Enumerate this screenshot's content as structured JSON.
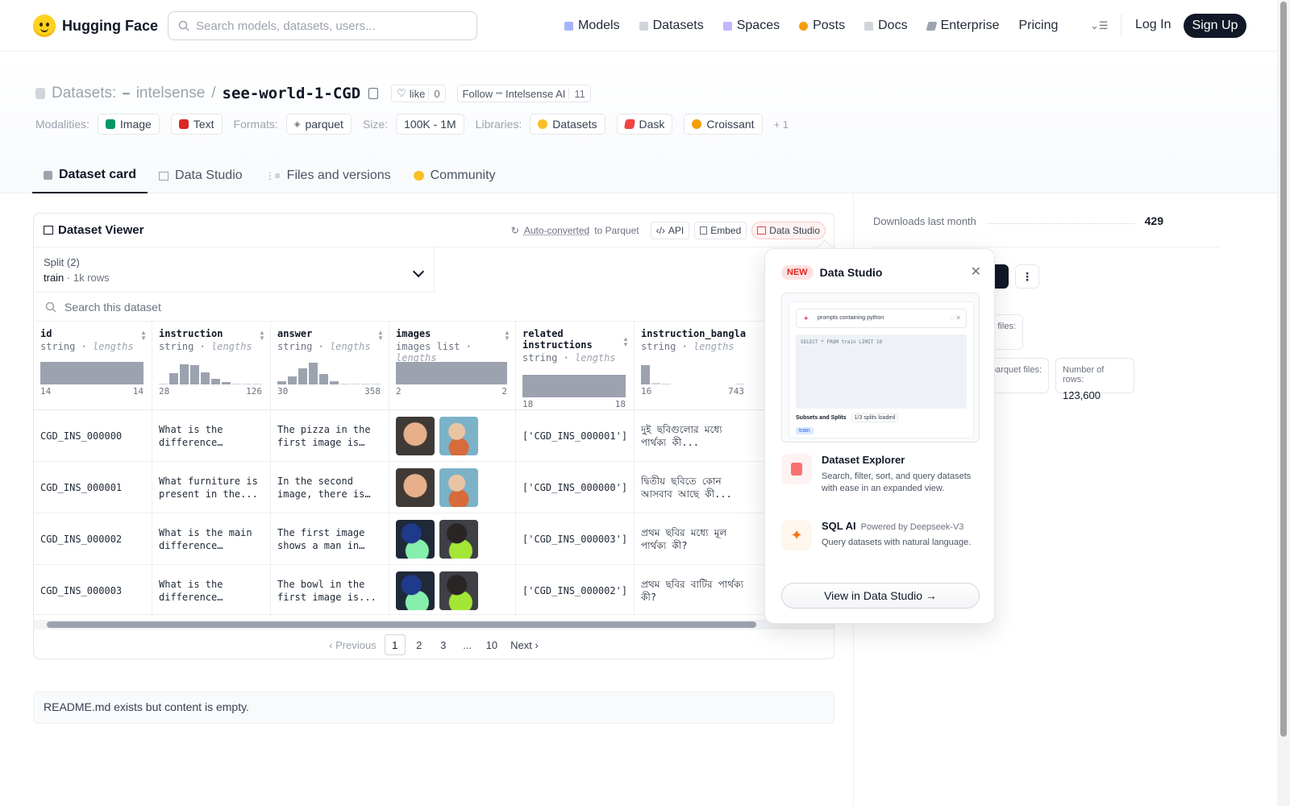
{
  "header": {
    "brand": "Hugging Face",
    "search_placeholder": "Search models, datasets, users...",
    "nav": [
      {
        "label": "Models",
        "icon": "models-icon",
        "color": "#6366f1"
      },
      {
        "label": "Datasets",
        "icon": "datasets-icon",
        "color": "#ef4444"
      },
      {
        "label": "Spaces",
        "icon": "spaces-icon",
        "color": "#8b5cf6"
      },
      {
        "label": "Posts",
        "icon": "posts-icon",
        "color": "#f59e0b"
      },
      {
        "label": "Docs",
        "icon": "docs-icon",
        "color": "#6b7280"
      },
      {
        "label": "Enterprise",
        "icon": "enterprise-icon",
        "color": "#6b7280"
      },
      {
        "label": "Pricing",
        "icon": "",
        "color": ""
      }
    ],
    "login": "Log In",
    "signup": "Sign Up"
  },
  "dataset": {
    "section": "Datasets:",
    "org": "intelsense",
    "name": "see-world-1-CGD",
    "like_label": "like",
    "like_count": "0",
    "follow_label": "Follow",
    "follow_org": "Intelsense AI",
    "follow_count": "11",
    "modalities_label": "Modalities:",
    "modalities": [
      "Image",
      "Text"
    ],
    "formats_label": "Formats:",
    "formats": [
      "parquet"
    ],
    "size_label": "Size:",
    "size": "100K - 1M",
    "libraries_label": "Libraries:",
    "libraries": [
      "Datasets",
      "Dask",
      "Croissant"
    ],
    "more_libraries": "+ 1"
  },
  "tabs": [
    "Dataset card",
    "Data Studio",
    "Files and versions",
    "Community"
  ],
  "viewer": {
    "title": "Dataset Viewer",
    "auto_converted": "Auto-converted",
    "to_parquet": "to Parquet",
    "api": "API",
    "embed": "Embed",
    "data_studio": "Data Studio",
    "split_label": "Split (2)",
    "split_value": "train",
    "split_rows": "1k rows",
    "search_placeholder": "Search this dataset",
    "columns": [
      {
        "name": "id",
        "type": "string",
        "sub": "lengths",
        "min": "14",
        "max": "14"
      },
      {
        "name": "instruction",
        "type": "string",
        "sub": "lengths",
        "min": "28",
        "max": "126"
      },
      {
        "name": "answer",
        "type": "string",
        "sub": "lengths",
        "min": "30",
        "max": "358"
      },
      {
        "name": "images",
        "type": "images list",
        "sub": "lengths",
        "min": "2",
        "max": "2"
      },
      {
        "name": "related instructions",
        "type": "string",
        "sub": "lengths",
        "min": "18",
        "max": "18"
      },
      {
        "name": "instruction_bangla",
        "type": "string",
        "sub": "lengths",
        "min": "16",
        "max": "743"
      }
    ],
    "rows": [
      {
        "id": "CGD_INS_000000",
        "instruction": "What is the difference between...",
        "answer": "The pizza in the first image is on...",
        "related": "['CGD_INS_000001']",
        "bangla": "দুই ছবিগুলোর মধ্যে পার্থক্য কী..."
      },
      {
        "id": "CGD_INS_000001",
        "instruction": "What furniture is present in the...",
        "answer": "In the second image, there is a...",
        "related": "['CGD_INS_000000']",
        "bangla": "দ্বিতীয় ছবিতে কোন আসবাব আছে কী..."
      },
      {
        "id": "CGD_INS_000002",
        "instruction": "What is the main difference between...",
        "answer": "The first image shows a man in a...",
        "related": "['CGD_INS_000003']",
        "bangla": "প্রথম ছবির মধ্যে মূল পার্থক্য কী?"
      },
      {
        "id": "CGD_INS_000003",
        "instruction": "What is the difference between...",
        "answer": "The bowl in the first image is...",
        "related": "['CGD_INS_000002']",
        "bangla": "প্রথম ছবির বাটির পার্থক্য কী?"
      }
    ],
    "pager": {
      "prev": "Previous",
      "pages": [
        "1",
        "2",
        "3",
        "...",
        "10"
      ],
      "next": "Next"
    }
  },
  "readme": "README.md exists but content is empty.",
  "sidebar": {
    "downloads_label": "Downloads last month",
    "downloads": "429",
    "files_label": "files:",
    "parquet_label": "parquet files:",
    "rows_label": "Number of rows:",
    "rows_value": "123,600"
  },
  "popover": {
    "badge": "NEW",
    "title": "Data Studio",
    "preview_query": "prompts containing python",
    "preview_sql": "SELECT * FROM train LIMIT 10",
    "preview_subsets": "Subsets and Splits",
    "preview_loaded": "1/3 splits loaded",
    "preview_train": "train",
    "explorer_title": "Dataset Explorer",
    "explorer_desc": "Search, filter, sort, and query datasets with ease in an expanded view.",
    "sql_title": "SQL AI",
    "sql_powered": "Powered by Deepseek-V3",
    "sql_desc": "Query datasets with natural language.",
    "button": "View in Data Studio →"
  }
}
